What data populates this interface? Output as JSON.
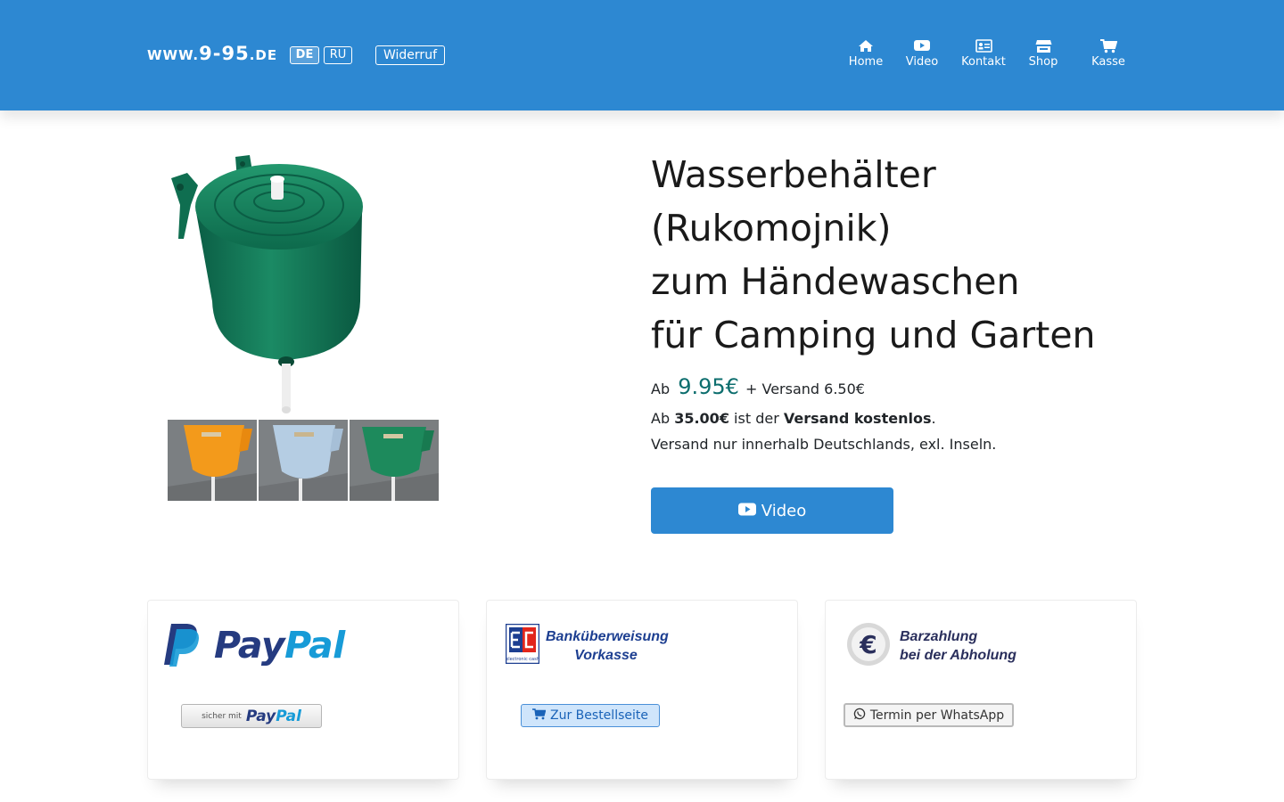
{
  "header": {
    "logo": {
      "prefix": "www.",
      "main": "9-95",
      "suffix": ".de"
    },
    "languages": [
      {
        "label": "DE",
        "active": true
      },
      {
        "label": "RU",
        "active": false
      }
    ],
    "widerruf_label": "Widerruf",
    "nav": [
      {
        "label": "Home",
        "icon": "home-icon"
      },
      {
        "label": "Video",
        "icon": "youtube-icon"
      },
      {
        "label": "Kontakt",
        "icon": "contact-card-icon"
      },
      {
        "label": "Shop",
        "icon": "store-icon"
      },
      {
        "label": "Kasse",
        "icon": "cart-icon"
      }
    ],
    "background_color": "#2d88d2"
  },
  "product": {
    "title_lines": [
      "Wasserbehälter",
      "(Rukomojnik)",
      "zum Händewaschen",
      "für Camping und Garten"
    ],
    "price_prefix": "Ab",
    "price": "9.95€",
    "shipping_text": "+ Versand 6.50€",
    "free_shipping": {
      "prefix": "Ab",
      "threshold": "35.00€",
      "middle": "ist der",
      "highlight": "Versand kostenlos",
      "end": "."
    },
    "shipping_note": "Versand nur innerhalb Deutschlands, exl. Inseln.",
    "video_button_label": "Video",
    "thumbnail_colors": [
      "orange",
      "light blue",
      "green"
    ]
  },
  "payments": {
    "paypal": {
      "logo_part1": "Pay",
      "logo_part2": "Pal",
      "button_small": "sicher mit",
      "button_part1": "Pay",
      "button_part2": "Pal"
    },
    "bank": {
      "logo_text": "electronic cash",
      "title_line1": "Banküberweisung",
      "title_line2": "Vorkasse",
      "button_label": "Zur Bestellseite"
    },
    "cash": {
      "title_line1": "Barzahlung",
      "title_line2": "bei der Abholung",
      "button_label": "Termin per WhatsApp"
    }
  },
  "colors": {
    "accent": "#2d88d2",
    "price": "#0d6e6e",
    "paypal_dark": "#253b80",
    "paypal_light": "#179bd7",
    "bank_title": "#1d3f91"
  }
}
